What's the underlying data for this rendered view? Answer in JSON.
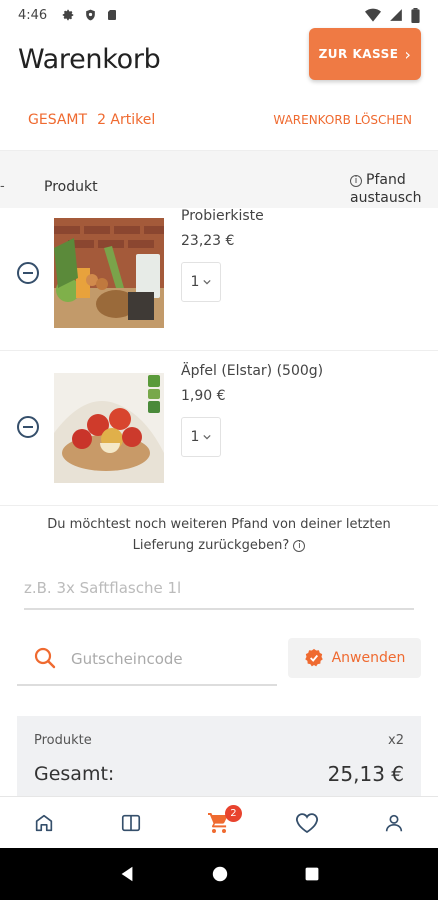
{
  "status": {
    "time": "4:46"
  },
  "header": {
    "title": "Warenkorb",
    "checkout_label": "ZUR KASSE",
    "checkout_chevron": "›"
  },
  "summary": {
    "total_label": "GESAMT",
    "item_count": "2 Artikel",
    "clear_label": "WARENKORB LÖSCHEN"
  },
  "table": {
    "dash": "-",
    "product_col": "Produkt",
    "info_glyph": "i",
    "pfand_line1": "Pfand",
    "pfand_line2": "austausch"
  },
  "items": [
    {
      "name": "Probierkiste",
      "price": "23,23 €",
      "qty": "1"
    },
    {
      "name": "Äpfel (Elstar) (500g)",
      "price": "1,90 €",
      "qty": "1"
    }
  ],
  "pfand": {
    "question": "Du möchtest noch weiteren Pfand von deiner letzten Lieferung zurückgeben?",
    "info_glyph": "i",
    "placeholder": "z.B. 3x Saftflasche 1l"
  },
  "coupon": {
    "placeholder": "Gutscheincode",
    "apply_label": "Anwenden"
  },
  "totals": {
    "products_label": "Produkte",
    "products_qty": "x2",
    "total_label": "Gesamt:",
    "total_value": "25,13 €"
  },
  "nav": {
    "cart_badge": "2"
  },
  "colors": {
    "accent": "#ef7a44",
    "accent_text": "#ef6a30",
    "icon_dark": "#354f6b",
    "badge": "#e8432e"
  }
}
